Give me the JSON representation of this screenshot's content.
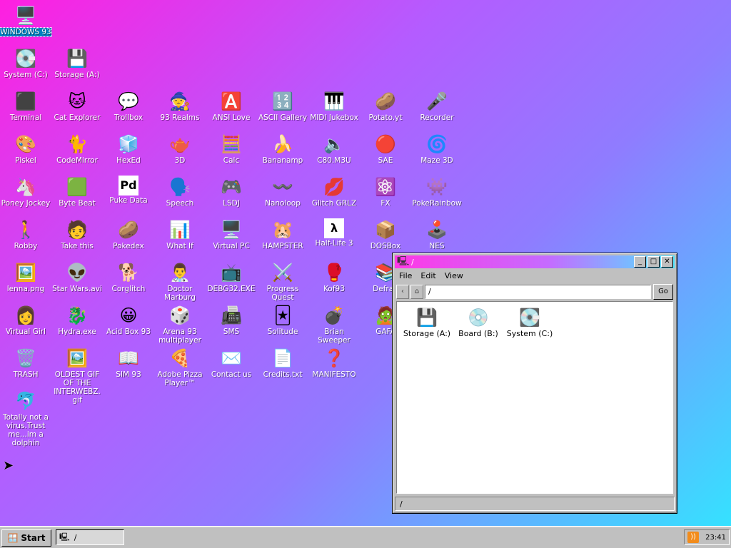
{
  "desktop": {
    "icons": [
      {
        "label": "WINDOWS 93",
        "glyph": "🖥️",
        "selected": true
      },
      {
        "label": "System (C:)",
        "glyph": "💽"
      },
      {
        "label": "Storage (A:)",
        "glyph": "💾"
      },
      {
        "label": "Terminal",
        "glyph": "⬛"
      },
      {
        "label": "Cat Explorer",
        "glyph": "🐱"
      },
      {
        "label": "Trollbox",
        "glyph": "💬"
      },
      {
        "label": "93 Realms",
        "glyph": "🧙"
      },
      {
        "label": "ANSI Love",
        "glyph": "🅰️"
      },
      {
        "label": "ASCII Gallery",
        "glyph": "🔢"
      },
      {
        "label": "MIDI Jukebox",
        "glyph": "🎹"
      },
      {
        "label": "Potato.yt",
        "glyph": "🥔"
      },
      {
        "label": "Recorder",
        "glyph": "🎤"
      },
      {
        "label": "Piskel",
        "glyph": "🎨"
      },
      {
        "label": "CodeMirror",
        "glyph": "🐈"
      },
      {
        "label": "HexEd",
        "glyph": "🧊"
      },
      {
        "label": "3D",
        "glyph": "🫖"
      },
      {
        "label": "Calc",
        "glyph": "🧮"
      },
      {
        "label": "Bananamp",
        "glyph": "🍌"
      },
      {
        "label": "C80.M3U",
        "glyph": "🔈"
      },
      {
        "label": "SAE",
        "glyph": "🔴"
      },
      {
        "label": "Maze 3D",
        "glyph": "🌀"
      },
      {
        "label": "Poney Jockey",
        "glyph": "🦄"
      },
      {
        "label": "Byte Beat",
        "glyph": "🟩"
      },
      {
        "label": "Puke Data",
        "glyph": "Pd"
      },
      {
        "label": "Speech",
        "glyph": "🗣️"
      },
      {
        "label": "LSDJ",
        "glyph": "🎮"
      },
      {
        "label": "Nanoloop",
        "glyph": "〰️"
      },
      {
        "label": "Glitch GRLZ",
        "glyph": "💋"
      },
      {
        "label": "FX",
        "glyph": "⚛️"
      },
      {
        "label": "PokeRainbow",
        "glyph": "👾"
      },
      {
        "label": "Robby",
        "glyph": "🚶"
      },
      {
        "label": "Take this",
        "glyph": "🧑"
      },
      {
        "label": "Pokedex",
        "glyph": "🥔"
      },
      {
        "label": "What If",
        "glyph": "📊"
      },
      {
        "label": "Virtual PC",
        "glyph": "🖥️"
      },
      {
        "label": "HAMPSTER",
        "glyph": "🐹"
      },
      {
        "label": "Half-Life 3",
        "glyph": "λ"
      },
      {
        "label": "DOSBox",
        "glyph": "📦"
      },
      {
        "label": "NES",
        "glyph": "🕹️"
      },
      {
        "label": "lenna.png",
        "glyph": "🖼️"
      },
      {
        "label": "Star Wars.avi",
        "glyph": "👽"
      },
      {
        "label": "Corglitch",
        "glyph": "🐕"
      },
      {
        "label": "Doctor Marburg",
        "glyph": "👨‍⚕️"
      },
      {
        "label": "DEBG32.EXE",
        "glyph": "📺"
      },
      {
        "label": "Progress Quest",
        "glyph": "⚔️"
      },
      {
        "label": "Kof93",
        "glyph": "🥊"
      },
      {
        "label": "Defrag",
        "glyph": "📚"
      },
      {
        "label": "Virtual Girl",
        "glyph": "👩"
      },
      {
        "label": "Hydra.exe",
        "glyph": "🐉"
      },
      {
        "label": "Acid Box 93",
        "glyph": "😀"
      },
      {
        "label": "Arena 93 multiplayer",
        "glyph": "🎲"
      },
      {
        "label": "SMS",
        "glyph": "📠"
      },
      {
        "label": "Solitude",
        "glyph": "🃏"
      },
      {
        "label": "Brian Sweeper",
        "glyph": "💣"
      },
      {
        "label": "GAFA",
        "glyph": "🧟"
      },
      {
        "label": "TRASH",
        "glyph": "🗑️"
      },
      {
        "label": "OLDEST GIF OF THE INTERWEBZ.gif",
        "glyph": "🖼️"
      },
      {
        "label": "SIM 93",
        "glyph": "📖"
      },
      {
        "label": "Adobe Pizza Player™",
        "glyph": "🍕"
      },
      {
        "label": "Contact us",
        "glyph": "✉️"
      },
      {
        "label": "Credits.txt",
        "glyph": "📄"
      },
      {
        "label": "MANIFESTO",
        "glyph": "❓"
      },
      {
        "label": "Totally not a virus.Trust me...im a dolphin",
        "glyph": "🐬"
      }
    ]
  },
  "window": {
    "title": "/",
    "title_icon": "computer-icon",
    "buttons": {
      "minimize": "_",
      "maximize": "□",
      "close": "✕"
    },
    "menu": [
      "File",
      "Edit",
      "View"
    ],
    "address": "/",
    "go_label": "Go",
    "items": [
      {
        "label": "Storage (A:)",
        "glyph": "💾"
      },
      {
        "label": "Board (B:)",
        "glyph": "💿"
      },
      {
        "label": "System (C:)",
        "glyph": "💽"
      }
    ],
    "status": "/"
  },
  "taskbar": {
    "start_label": "Start",
    "task_label": "/",
    "clock": "23:41"
  },
  "colors": {
    "window_chrome": "#c0c0c0",
    "title_gradient_start": "#ff38e6",
    "title_gradient_end": "#4ee6ff",
    "selected_label_bg": "#0080c0"
  }
}
